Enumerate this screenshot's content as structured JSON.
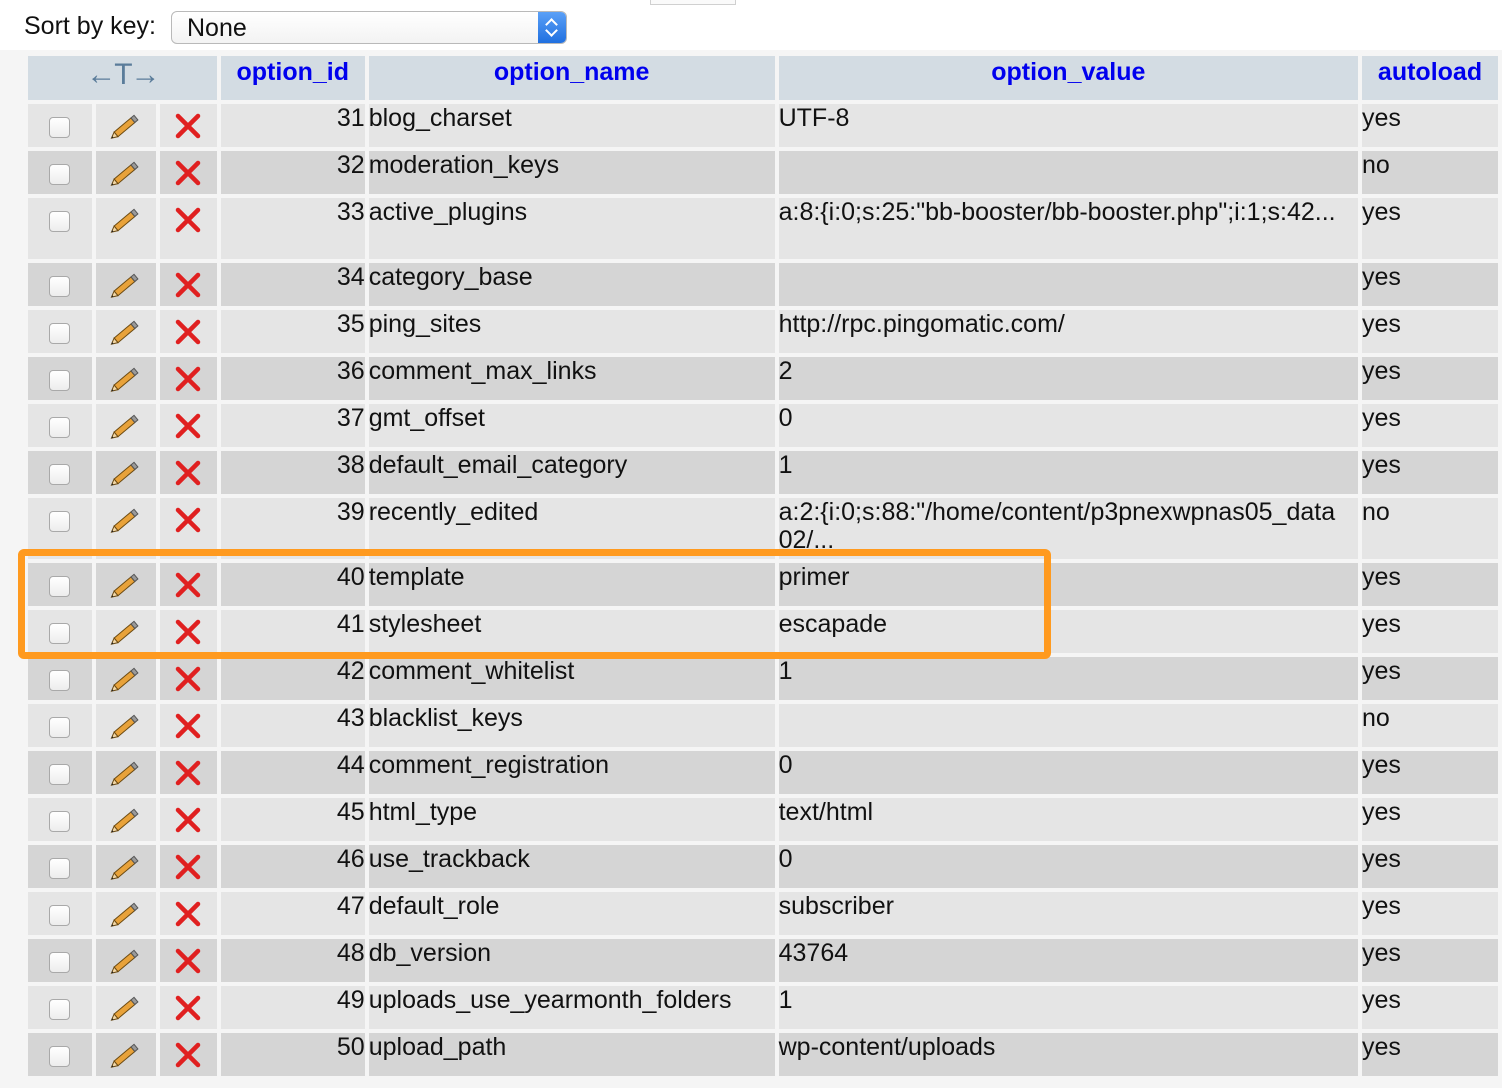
{
  "sort": {
    "label": "Sort by key:",
    "selected": "None"
  },
  "columns": {
    "controls_icon": "←T→",
    "option_id": "option_id",
    "option_name": "option_name",
    "option_value": "option_value",
    "autoload": "autoload"
  },
  "icons": {
    "edit": "pencil-icon",
    "delete": "red-x-icon"
  },
  "colors": {
    "highlight": "#ff9a1f",
    "header_link": "#0000ee",
    "delete": "#e02020"
  },
  "rows": [
    {
      "id": "31",
      "name": "blog_charset",
      "value": "UTF-8",
      "autoload": "yes"
    },
    {
      "id": "32",
      "name": "moderation_keys",
      "value": "",
      "autoload": "no"
    },
    {
      "id": "33",
      "name": "active_plugins",
      "value": "a:8:{i:0;s:25:\"bb-booster/bb-booster.php\";i:1;s:42...",
      "autoload": "yes"
    },
    {
      "id": "34",
      "name": "category_base",
      "value": "",
      "autoload": "yes"
    },
    {
      "id": "35",
      "name": "ping_sites",
      "value": "http://rpc.pingomatic.com/",
      "autoload": "yes"
    },
    {
      "id": "36",
      "name": "comment_max_links",
      "value": "2",
      "autoload": "yes"
    },
    {
      "id": "37",
      "name": "gmt_offset",
      "value": "0",
      "autoload": "yes"
    },
    {
      "id": "38",
      "name": "default_email_category",
      "value": "1",
      "autoload": "yes"
    },
    {
      "id": "39",
      "name": "recently_edited",
      "value": "a:2:{i:0;s:88:\"/home/content/p3pnexwpnas05_data02/...",
      "autoload": "no"
    },
    {
      "id": "40",
      "name": "template",
      "value": "primer",
      "autoload": "yes"
    },
    {
      "id": "41",
      "name": "stylesheet",
      "value": "escapade",
      "autoload": "yes"
    },
    {
      "id": "42",
      "name": "comment_whitelist",
      "value": "1",
      "autoload": "yes"
    },
    {
      "id": "43",
      "name": "blacklist_keys",
      "value": "",
      "autoload": "no"
    },
    {
      "id": "44",
      "name": "comment_registration",
      "value": "0",
      "autoload": "yes"
    },
    {
      "id": "45",
      "name": "html_type",
      "value": "text/html",
      "autoload": "yes"
    },
    {
      "id": "46",
      "name": "use_trackback",
      "value": "0",
      "autoload": "yes"
    },
    {
      "id": "47",
      "name": "default_role",
      "value": "subscriber",
      "autoload": "yes"
    },
    {
      "id": "48",
      "name": "db_version",
      "value": "43764",
      "autoload": "yes"
    },
    {
      "id": "49",
      "name": "uploads_use_yearmonth_folders",
      "value": "1",
      "autoload": "yes"
    },
    {
      "id": "50",
      "name": "upload_path",
      "value": "wp-content/uploads",
      "autoload": "yes"
    }
  ]
}
